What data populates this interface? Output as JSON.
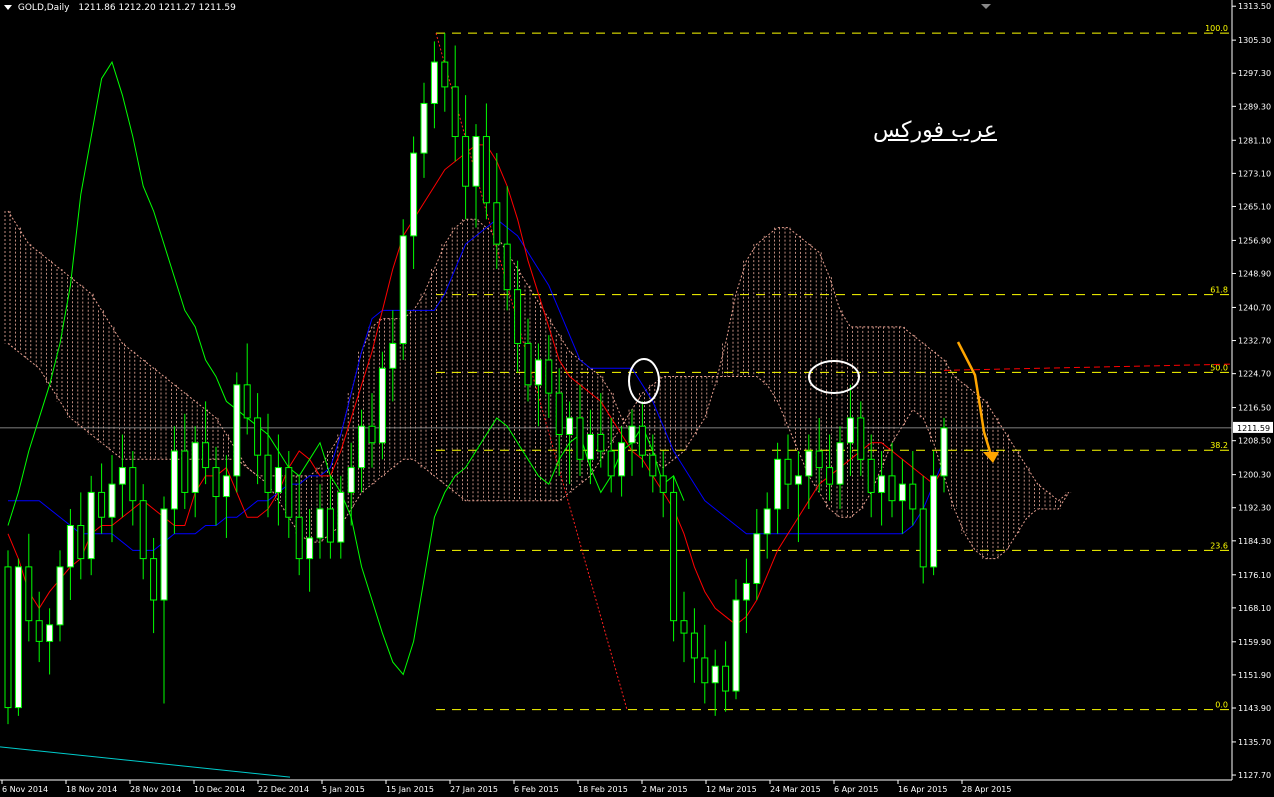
{
  "header": {
    "symbol": "GOLD,Daily",
    "ohlc": "1211.86 1212.20 1211.27 1211.59"
  },
  "watermark": "عرب فوركس",
  "colors": {
    "background": "#000000",
    "bull_candle": "#ffffff",
    "bear_candle": "#000000",
    "candle_wick": "#00ff00",
    "tenkan": "#ff0000",
    "kijun": "#0000ff",
    "chikou": "#00ff00",
    "cloud_border": "#e8a090",
    "fib_levels": "#ffff00",
    "arrow": "#ffa500",
    "bid_line": "#aaaaaa",
    "axis_text": "#ffffff",
    "trendline": "#00cccc"
  },
  "chart_data": {
    "type": "candlestick",
    "title": "GOLD,Daily",
    "ylim": [
      1126.5,
      1315.0
    ],
    "y_ticks": [
      "1313.50",
      "1305.30",
      "1297.30",
      "1289.30",
      "1281.10",
      "1273.10",
      "1265.10",
      "1256.90",
      "1248.90",
      "1240.70",
      "1232.70",
      "1224.70",
      "1216.50",
      "1208.50",
      "1200.30",
      "1192.30",
      "1184.30",
      "1176.10",
      "1168.10",
      "1159.90",
      "1151.90",
      "1143.90",
      "1135.70",
      "1127.70"
    ],
    "x_ticks": [
      "6 Nov 2014",
      "18 Nov 2014",
      "28 Nov 2014",
      "10 Dec 2014",
      "22 Dec 2014",
      "5 Jan 2015",
      "15 Jan 2015",
      "27 Jan 2015",
      "6 Feb 2015",
      "18 Feb 2015",
      "2 Mar 2015",
      "12 Mar 2015",
      "24 Mar 2015",
      "6 Apr 2015",
      "16 Apr 2015",
      "28 Apr 2015"
    ],
    "current_price": "1211.59",
    "fibonacci": [
      {
        "label": "100.0",
        "price": 1307.0
      },
      {
        "label": "61.8",
        "price": 1243.8
      },
      {
        "label": "50.0",
        "price": 1225.0
      },
      {
        "label": "38.2",
        "price": 1206.2
      },
      {
        "label": "23.6",
        "price": 1182.0
      },
      {
        "label": "0.0",
        "price": 1143.5
      }
    ],
    "candles": [
      [
        1178,
        1182,
        1140,
        1144
      ],
      [
        1144,
        1180,
        1142,
        1178
      ],
      [
        1178,
        1186,
        1160,
        1165
      ],
      [
        1165,
        1172,
        1155,
        1160
      ],
      [
        1160,
        1168,
        1152,
        1164
      ],
      [
        1164,
        1182,
        1160,
        1178
      ],
      [
        1178,
        1192,
        1170,
        1188
      ],
      [
        1188,
        1196,
        1175,
        1180
      ],
      [
        1180,
        1200,
        1176,
        1196
      ],
      [
        1196,
        1203,
        1186,
        1190
      ],
      [
        1190,
        1205,
        1184,
        1198
      ],
      [
        1198,
        1210,
        1190,
        1202
      ],
      [
        1202,
        1206,
        1188,
        1194
      ],
      [
        1194,
        1198,
        1175,
        1180
      ],
      [
        1180,
        1185,
        1162,
        1170
      ],
      [
        1170,
        1195,
        1145,
        1192
      ],
      [
        1192,
        1212,
        1186,
        1206
      ],
      [
        1206,
        1215,
        1192,
        1196
      ],
      [
        1196,
        1212,
        1190,
        1208
      ],
      [
        1208,
        1218,
        1198,
        1202
      ],
      [
        1202,
        1207,
        1188,
        1195
      ],
      [
        1195,
        1205,
        1185,
        1200
      ],
      [
        1200,
        1225,
        1196,
        1222
      ],
      [
        1222,
        1232,
        1210,
        1214
      ],
      [
        1214,
        1220,
        1198,
        1205
      ],
      [
        1205,
        1215,
        1190,
        1196
      ],
      [
        1196,
        1210,
        1188,
        1202
      ],
      [
        1202,
        1206,
        1185,
        1190
      ],
      [
        1190,
        1200,
        1176,
        1180
      ],
      [
        1180,
        1192,
        1172,
        1185
      ],
      [
        1185,
        1198,
        1180,
        1192
      ],
      [
        1192,
        1200,
        1180,
        1184
      ],
      [
        1184,
        1200,
        1180,
        1196
      ],
      [
        1196,
        1208,
        1188,
        1202
      ],
      [
        1202,
        1216,
        1196,
        1212
      ],
      [
        1212,
        1220,
        1202,
        1208
      ],
      [
        1208,
        1230,
        1204,
        1226
      ],
      [
        1226,
        1240,
        1218,
        1232
      ],
      [
        1232,
        1262,
        1228,
        1258
      ],
      [
        1258,
        1282,
        1250,
        1278
      ],
      [
        1278,
        1295,
        1272,
        1290
      ],
      [
        1290,
        1305,
        1284,
        1300
      ],
      [
        1300,
        1307,
        1288,
        1294
      ],
      [
        1294,
        1304,
        1276,
        1282
      ],
      [
        1282,
        1292,
        1262,
        1270
      ],
      [
        1270,
        1285,
        1260,
        1282
      ],
      [
        1282,
        1290,
        1262,
        1266
      ],
      [
        1266,
        1278,
        1250,
        1256
      ],
      [
        1256,
        1270,
        1240,
        1245
      ],
      [
        1245,
        1252,
        1225,
        1232
      ],
      [
        1232,
        1238,
        1218,
        1222
      ],
      [
        1222,
        1232,
        1212,
        1228
      ],
      [
        1228,
        1234,
        1214,
        1220
      ],
      [
        1220,
        1226,
        1200,
        1210
      ],
      [
        1210,
        1218,
        1198,
        1214
      ],
      [
        1214,
        1222,
        1200,
        1204
      ],
      [
        1204,
        1216,
        1198,
        1210
      ],
      [
        1210,
        1220,
        1202,
        1206
      ],
      [
        1206,
        1214,
        1196,
        1200
      ],
      [
        1200,
        1212,
        1195,
        1208
      ],
      [
        1208,
        1216,
        1200,
        1212
      ],
      [
        1212,
        1218,
        1202,
        1205
      ],
      [
        1205,
        1210,
        1196,
        1200
      ],
      [
        1200,
        1206,
        1190,
        1196
      ],
      [
        1196,
        1200,
        1160,
        1165
      ],
      [
        1165,
        1172,
        1155,
        1162
      ],
      [
        1162,
        1168,
        1150,
        1156
      ],
      [
        1156,
        1164,
        1145,
        1150
      ],
      [
        1150,
        1158,
        1142,
        1154
      ],
      [
        1154,
        1160,
        1143,
        1148
      ],
      [
        1148,
        1175,
        1146,
        1170
      ],
      [
        1170,
        1180,
        1162,
        1174
      ],
      [
        1174,
        1192,
        1170,
        1186
      ],
      [
        1186,
        1196,
        1180,
        1192
      ],
      [
        1192,
        1208,
        1186,
        1204
      ],
      [
        1204,
        1210,
        1192,
        1198
      ],
      [
        1198,
        1206,
        1184,
        1200
      ],
      [
        1200,
        1210,
        1192,
        1206
      ],
      [
        1206,
        1214,
        1196,
        1202
      ],
      [
        1202,
        1210,
        1194,
        1198
      ],
      [
        1198,
        1212,
        1192,
        1208
      ],
      [
        1208,
        1222,
        1200,
        1214
      ],
      [
        1214,
        1218,
        1200,
        1204
      ],
      [
        1204,
        1210,
        1190,
        1196
      ],
      [
        1196,
        1206,
        1188,
        1200
      ],
      [
        1200,
        1208,
        1190,
        1194
      ],
      [
        1194,
        1204,
        1186,
        1198
      ],
      [
        1198,
        1206,
        1188,
        1192
      ],
      [
        1192,
        1200,
        1174,
        1178
      ],
      [
        1178,
        1206,
        1176,
        1200
      ],
      [
        1200,
        1214,
        1196,
        1211.59
      ]
    ],
    "tenkan": [
      1186,
      1180,
      1172,
      1168,
      1172,
      1175,
      1178,
      1180,
      1186,
      1188,
      1188,
      1190,
      1192,
      1194,
      1192,
      1190,
      1188,
      1188,
      1196,
      1200,
      1200,
      1202,
      1196,
      1190,
      1190,
      1192,
      1196,
      1202,
      1206,
      1204,
      1200,
      1200,
      1206,
      1214,
      1222,
      1230,
      1240,
      1250,
      1258,
      1262,
      1266,
      1270,
      1274,
      1276,
      1278,
      1280,
      1280,
      1276,
      1270,
      1262,
      1252,
      1244,
      1236,
      1228,
      1224,
      1222,
      1220,
      1218,
      1214,
      1210,
      1206,
      1204,
      1200,
      1196,
      1192,
      1186,
      1178,
      1172,
      1168,
      1166,
      1164,
      1166,
      1170,
      1176,
      1182,
      1186,
      1190,
      1194,
      1198,
      1200,
      1202,
      1204,
      1206,
      1208,
      1208,
      1206,
      1204,
      1202,
      1200,
      1198,
      1202
    ],
    "kijun": [
      1194,
      1194,
      1194,
      1194,
      1192,
      1190,
      1188,
      1186,
      1186,
      1186,
      1186,
      1184,
      1182,
      1182,
      1182,
      1184,
      1186,
      1186,
      1186,
      1188,
      1188,
      1190,
      1190,
      1192,
      1194,
      1194,
      1196,
      1198,
      1198,
      1200,
      1200,
      1202,
      1210,
      1220,
      1230,
      1238,
      1240,
      1240,
      1240,
      1240,
      1240,
      1240,
      1244,
      1250,
      1256,
      1258,
      1260,
      1262,
      1260,
      1258,
      1254,
      1250,
      1246,
      1240,
      1234,
      1228,
      1226,
      1226,
      1226,
      1226,
      1226,
      1222,
      1218,
      1212,
      1206,
      1202,
      1198,
      1194,
      1192,
      1190,
      1188,
      1186,
      1186,
      1186,
      1186,
      1186,
      1186,
      1186,
      1186,
      1186,
      1186,
      1186,
      1186,
      1186,
      1186,
      1186,
      1186,
      1188,
      1192,
      1198,
      1204
    ],
    "chikou": [
      1188,
      1196,
      1206,
      1214,
      1222,
      1232,
      1246,
      1268,
      1282,
      1296,
      1300,
      1292,
      1282,
      1270,
      1264,
      1256,
      1248,
      1240,
      1236,
      1228,
      1224,
      1218,
      1216,
      1214,
      1212,
      1210,
      1206,
      1202,
      1200,
      1204,
      1208,
      1200,
      1196,
      1190,
      1178,
      1170,
      1162,
      1155,
      1152,
      1160,
      1175,
      1190,
      1196,
      1200,
      1202,
      1206,
      1210,
      1214,
      1212,
      1208,
      1204,
      1200,
      1198,
      1204,
      1208,
      1210,
      1202,
      1196,
      1200,
      1206,
      1208,
      1212,
      1206,
      1198,
      1200,
      1194
    ],
    "cloud_top": [
      1264,
      1260,
      1256,
      1254,
      1252,
      1250,
      1248,
      1246,
      1244,
      1240,
      1236,
      1232,
      1230,
      1228,
      1226,
      1224,
      1222,
      1220,
      1218,
      1216,
      1214,
      1210,
      1206,
      1202,
      1200,
      1200,
      1200,
      1200,
      1200,
      1200,
      1202,
      1206,
      1210,
      1220,
      1230,
      1236,
      1238,
      1238,
      1238,
      1240,
      1244,
      1250,
      1256,
      1260,
      1262,
      1262,
      1260,
      1258,
      1254,
      1250,
      1246,
      1242,
      1238,
      1234,
      1230,
      1228,
      1226,
      1224,
      1220,
      1214,
      1210,
      1206,
      1204,
      1202,
      1204,
      1206,
      1210,
      1214,
      1222,
      1232,
      1244,
      1252,
      1256,
      1258,
      1260,
      1260,
      1258,
      1256,
      1254,
      1248,
      1240,
      1236,
      1236,
      1236,
      1236,
      1236,
      1236,
      1234,
      1232,
      1230,
      1228,
      1224,
      1222,
      1220,
      1218,
      1214,
      1210,
      1206,
      1202,
      1198,
      1196,
      1194,
      1196
    ],
    "cloud_bottom": [
      1232,
      1230,
      1228,
      1226,
      1222,
      1218,
      1214,
      1212,
      1210,
      1208,
      1206,
      1204,
      1204,
      1204,
      1204,
      1204,
      1204,
      1204,
      1204,
      1204,
      1204,
      1204,
      1204,
      1202,
      1200,
      1198,
      1194,
      1190,
      1186,
      1184,
      1184,
      1186,
      1188,
      1192,
      1196,
      1198,
      1200,
      1202,
      1204,
      1204,
      1202,
      1200,
      1198,
      1196,
      1194,
      1194,
      1194,
      1194,
      1194,
      1194,
      1194,
      1194,
      1194,
      1194,
      1196,
      1198,
      1200,
      1204,
      1208,
      1212,
      1216,
      1220,
      1222,
      1224,
      1224,
      1224,
      1224,
      1224,
      1224,
      1224,
      1224,
      1224,
      1224,
      1222,
      1218,
      1212,
      1206,
      1200,
      1196,
      1192,
      1190,
      1190,
      1192,
      1196,
      1202,
      1208,
      1212,
      1216,
      1214,
      1208,
      1200,
      1192,
      1186,
      1182,
      1180,
      1180,
      1182,
      1186,
      1190,
      1192,
      1192,
      1192,
      1196
    ]
  }
}
